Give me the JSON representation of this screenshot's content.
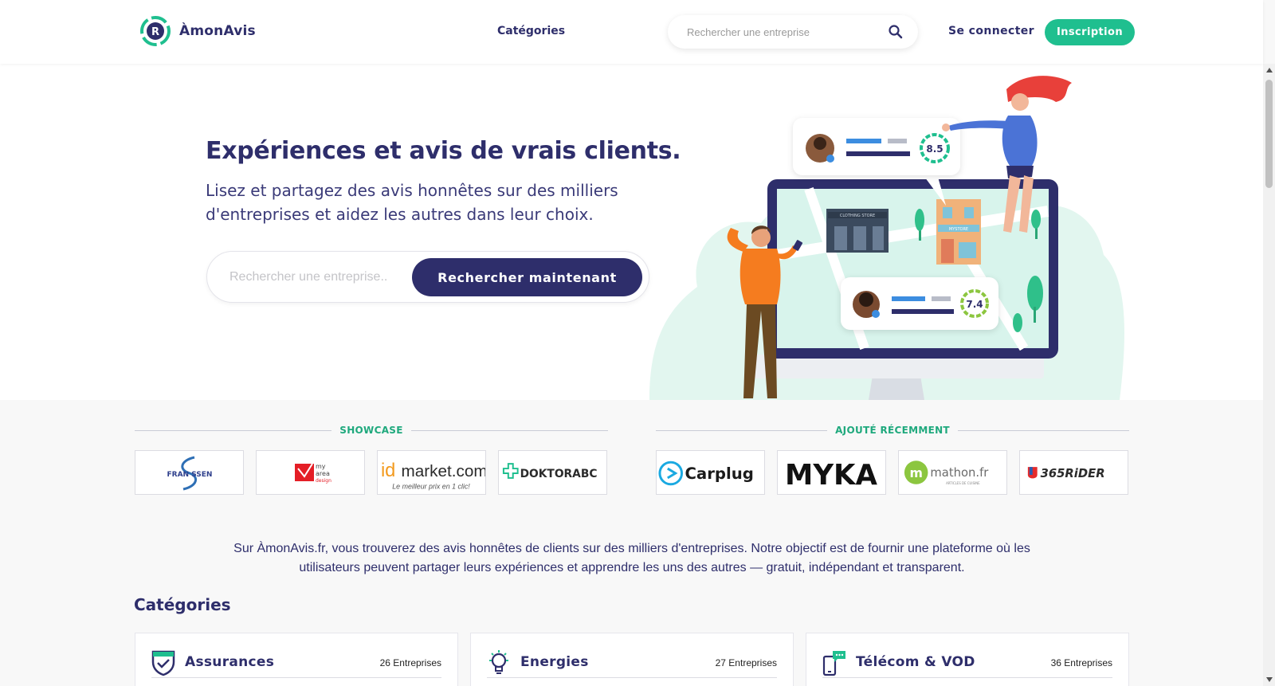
{
  "header": {
    "brand": "ÀmonAvis",
    "brand_letter": "R",
    "nav_categories": "Catégories",
    "search_placeholder": "Rechercher une entreprise",
    "login": "Se connecter",
    "signup": "Inscription"
  },
  "hero": {
    "title": "Expériences et avis de vrais clients.",
    "subtitle": "Lisez et partagez des avis honnêtes sur des milliers d'entreprises et aidez les autres dans leur choix.",
    "search_placeholder": "Rechercher une entreprise..",
    "search_button": "Rechercher maintenant",
    "illustration": {
      "score_top": "8.5",
      "score_bottom": "7.4",
      "store_left": "CLOTHING STORE",
      "store_right": "MYSTORE"
    }
  },
  "showcase": {
    "label": "SHOWCASE",
    "logos": [
      {
        "name": "Franssen",
        "text": "FRAN SSEN"
      },
      {
        "name": "My Area Design",
        "text_line1": "my",
        "text_line2": "area",
        "text_line3": "design"
      },
      {
        "name": "idmarket.com",
        "text": "market.com",
        "prefix": "id",
        "tagline": "Le meilleur prix en 1 clic!"
      },
      {
        "name": "DoktorABC",
        "text": "DOKTORABC"
      }
    ]
  },
  "recent": {
    "label": "AJOUTÉ RÉCEMMENT",
    "logos": [
      {
        "name": "Carplug",
        "text": "Carplug"
      },
      {
        "name": "MYKA",
        "text": "MYKA"
      },
      {
        "name": "Mathon",
        "text": "mathon.fr",
        "tagline": "ARTICLES DE CUISINE"
      },
      {
        "name": "365 Rider",
        "text": "365RiDER"
      }
    ]
  },
  "intro": "Sur ÀmonAvis.fr, vous trouverez des avis honnêtes de clients sur des milliers d'entreprises. Notre objectif est de fournir une plateforme où les utilisateurs peuvent partager leurs expériences et apprendre les uns des autres — gratuit, indépendant et transparent.",
  "categories": {
    "title": "Catégories",
    "items": [
      {
        "name": "Assurances",
        "count": "26 Entreprises",
        "icon": "shield-check-icon"
      },
      {
        "name": "Energies",
        "count": "27 Entreprises",
        "icon": "lightbulb-icon"
      },
      {
        "name": "Télécom & VOD",
        "count": "36 Entreprises",
        "icon": "phone-chat-icon"
      }
    ]
  },
  "colors": {
    "primary": "#2e2e6b",
    "accent": "#1fbf8f",
    "background": "#f8f8f8"
  }
}
